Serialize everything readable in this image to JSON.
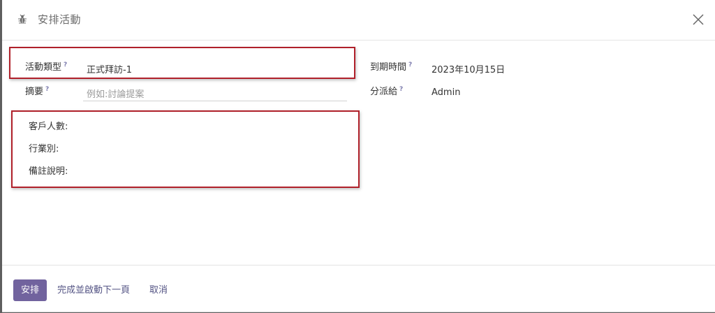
{
  "dialog": {
    "title": "安排活動",
    "icon": "bug-icon",
    "close_icon": "close-icon"
  },
  "fields": {
    "activity_type": {
      "label": "活動類型",
      "help": "?",
      "value": "正式拜訪-1"
    },
    "summary": {
      "label": "摘要",
      "help": "?",
      "placeholder": "例如:討論提案"
    },
    "due_date": {
      "label": "到期時間",
      "help": "?",
      "value": "2023年10月15日"
    },
    "assigned_to": {
      "label": "分派給",
      "help": "?",
      "value": "Admin"
    }
  },
  "custom_fields": {
    "customer_count": "客戶人數:",
    "industry": "行業別:",
    "notes": "備註說明:"
  },
  "footer": {
    "schedule_label": "安排",
    "done_next_label": "完成並啟動下一頁",
    "cancel_label": "取消"
  },
  "colors": {
    "primary": "#71639e",
    "highlight_border": "#b0202a",
    "link": "#545484"
  }
}
